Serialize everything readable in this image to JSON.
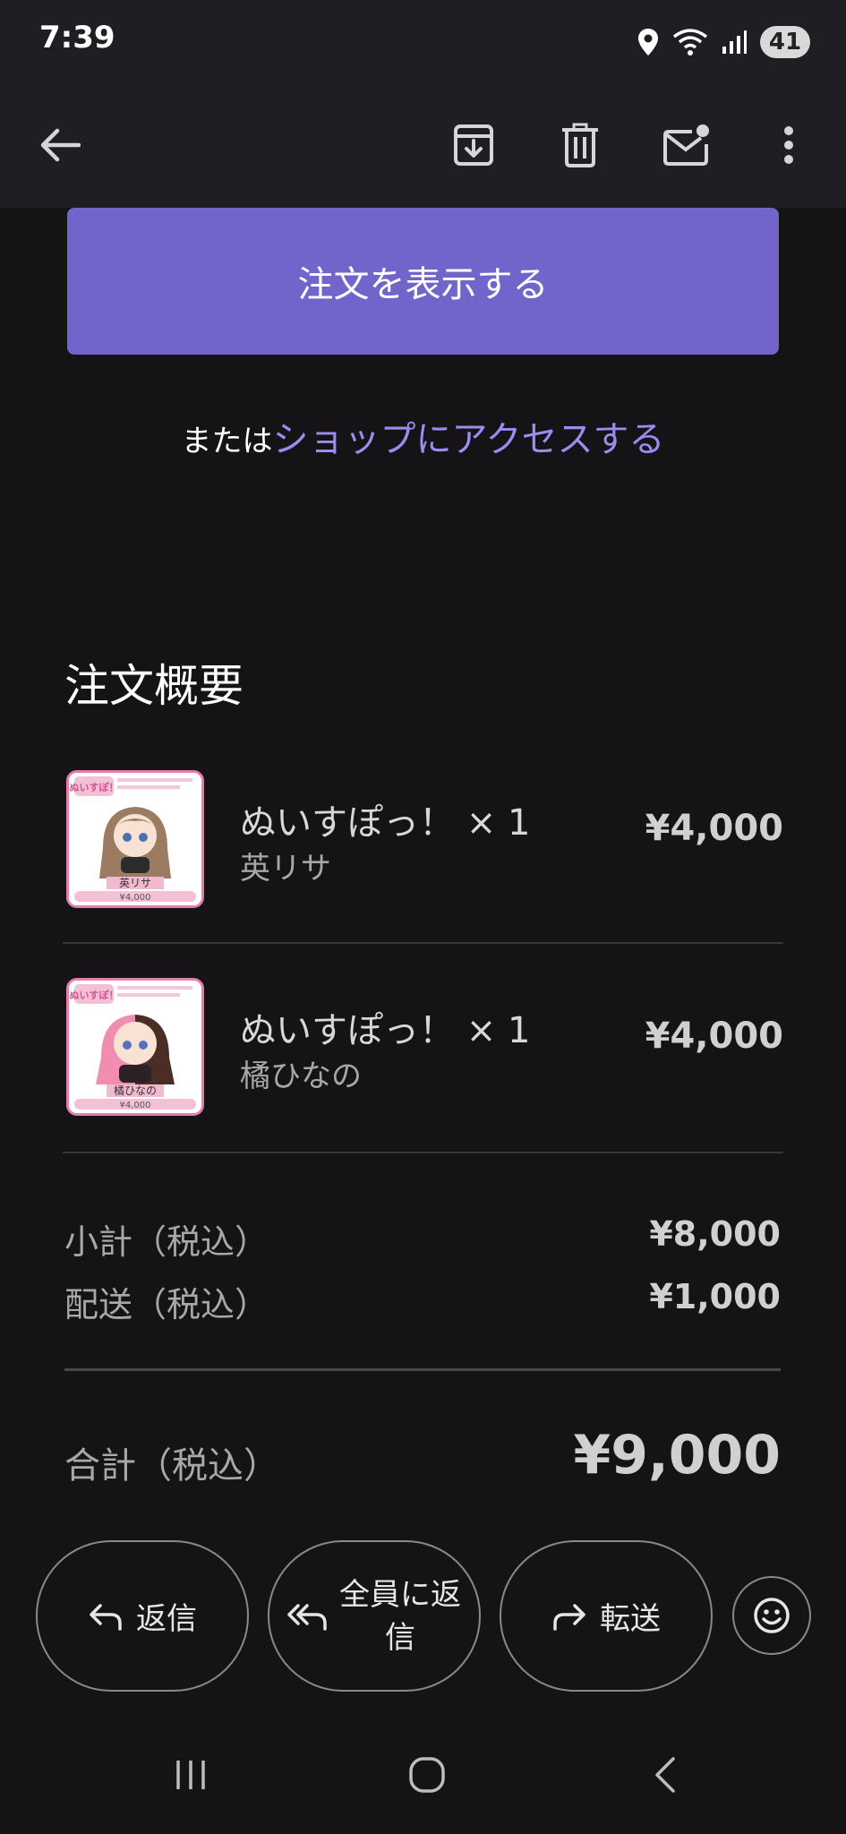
{
  "status_bar": {
    "time": "7:39",
    "battery": "41"
  },
  "order": {
    "view_button_label": "注文を表示する",
    "or_prefix": "または",
    "shop_link_label": "ショップにアクセスする"
  },
  "summary": {
    "title": "注文概要",
    "items": [
      {
        "name": "ぬいすぽっ！ × 1",
        "variant": "英リサ",
        "price": "¥4,000",
        "thumb_caption": "英リサ",
        "thumb_price": "¥4,000",
        "thumb_logo": "ぬいすぽ！"
      },
      {
        "name": "ぬいすぽっ！ × 1",
        "variant": "橘ひなの",
        "price": "¥4,000",
        "thumb_caption": "橘ひなの",
        "thumb_price": "¥4,000",
        "thumb_logo": "ぬいすぽ！"
      }
    ],
    "subtotal_label": "小計（税込）",
    "subtotal_value": "¥8,000",
    "shipping_label": "配送（税込）",
    "shipping_value": "¥1,000",
    "total_label": "合計（税込）",
    "total_value": "¥9,000"
  },
  "actions": {
    "reply": "返信",
    "reply_all": "全員に返信",
    "reply_all_line1": "全員に返",
    "reply_all_line2": "信",
    "forward": "転送"
  },
  "icons": {
    "back": "arrow-back-icon",
    "archive": "archive-icon",
    "delete": "trash-icon",
    "mark_unread": "mail-unread-icon",
    "more": "more-vert-icon",
    "emoji": "emoji-icon"
  },
  "colors": {
    "accent_button": "#7165cc",
    "link": "#9a8df2",
    "background": "#161317",
    "bar": "#211e23"
  }
}
